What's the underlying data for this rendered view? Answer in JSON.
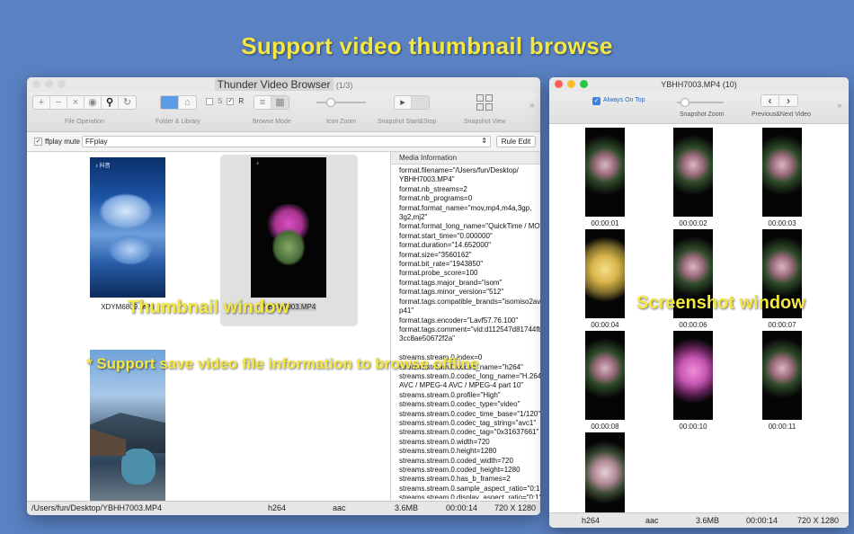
{
  "headline": "Support video thumbnail browse",
  "overlays": {
    "thumbnail_window": "Thumbnail window",
    "support_save": "* Support save video file information to browse offline",
    "screenshot_window": "Screenshot window"
  },
  "main_window": {
    "title": "Thunder Video Browser",
    "count": "(1/3)",
    "toolbar": {
      "file_operation": "File Operation",
      "folder_library": "Folder & Library",
      "s_label": "S",
      "r_label": "R",
      "browse_mode": "Browse Mode",
      "icon_zoom": "Icon Zoom",
      "snapshot_start_stop": "Snapshot  Start&Stop",
      "snapshot_view": "Snapshot View"
    },
    "subbar": {
      "ffplay_mute": "ffplay mute",
      "player_value": "FFplay",
      "rule_edit": "Rule Edit"
    },
    "thumbnails": [
      {
        "filename": "XDYM6809.MP4",
        "selected": false
      },
      {
        "filename": "YBHH7003.MP4",
        "selected": true
      },
      {
        "filename": "",
        "selected": false
      }
    ],
    "info_panel": {
      "header": "Media Information",
      "lines": [
        "format.filename=\"/Users/fun/Desktop/",
        "YBHH7003.MP4\"",
        "format.nb_streams=2",
        "format.nb_programs=0",
        "format.format_name=\"mov,mp4,m4a,3gp,",
        "3g2,mj2\"",
        "format.format_long_name=\"QuickTime / MOV\"",
        "format.start_time=\"0.000000\"",
        "format.duration=\"14.652000\"",
        "format.size=\"3560162\"",
        "format.bit_rate=\"1943850\"",
        "format.probe_score=100",
        "format.tags.major_brand=\"isom\"",
        "format.tags.minor_version=\"512\"",
        "format.tags.compatible_brands=\"isomiso2avc1m",
        "p41\"",
        "format.tags.encoder=\"Lavf57.76.100\"",
        "format.tags.comment=\"vid:d112547d81744fb286",
        "3cc8ae50672f2a\"",
        "",
        "streams.stream.0.index=0",
        "streams.stream.0.codec_name=\"h264\"",
        "streams.stream.0.codec_long_name=\"H.264 /",
        "AVC / MPEG-4 AVC / MPEG-4 part 10\"",
        "streams.stream.0.profile=\"High\"",
        "streams.stream.0.codec_type=\"video\"",
        "streams.stream.0.codec_time_base=\"1/120\"",
        "streams.stream.0.codec_tag_string=\"avc1\"",
        "streams.stream.0.codec_tag=\"0x31637661\"",
        "streams.stream.0.width=720",
        "streams.stream.0.height=1280",
        "streams.stream.0.coded_width=720",
        "streams.stream.0.coded_height=1280",
        "streams.stream.0.has_b_frames=2",
        "streams.stream.0.sample_aspect_ratio=\"0:1\"",
        "streams.stream.0.display_aspect_ratio=\"0:1\""
      ]
    },
    "status": {
      "path": "/Users/fun/Desktop/YBHH7003.MP4",
      "vcodec": "h264",
      "acodec": "aac",
      "size": "3.6MB",
      "duration": "00:00:14",
      "resolution": "720 X 1280"
    }
  },
  "snapshot_window": {
    "title": "YBHH7003.MP4",
    "count": "(10)",
    "always_on_top": "Always On Top",
    "always_on_top_checked": true,
    "snapshot_zoom": "Snapshot Zoom",
    "prev_next": "Previous&Next Video",
    "frames": [
      {
        "time": "00:00:01",
        "style": "cactus"
      },
      {
        "time": "00:00:02",
        "style": "cactus"
      },
      {
        "time": "00:00:03",
        "style": "cactus"
      },
      {
        "time": "00:00:04",
        "style": "yellow"
      },
      {
        "time": "00:00:06",
        "style": "cactus"
      },
      {
        "time": "00:00:07",
        "style": "cactus"
      },
      {
        "time": "00:00:08",
        "style": "cactus"
      },
      {
        "time": "00:00:10",
        "style": "pink"
      },
      {
        "time": "00:00:11",
        "style": "cactus"
      },
      {
        "time": "",
        "style": "white"
      }
    ],
    "status": {
      "vcodec": "h264",
      "acodec": "aac",
      "size": "3.6MB",
      "duration": "00:00:14",
      "resolution": "720 X 1280"
    }
  },
  "colors": {
    "desktop": "#5a82c3",
    "overlay_text": "#f5e742",
    "accent": "#3b82e0"
  },
  "icons": {
    "add": "+",
    "remove": "−",
    "close": "×",
    "eye": "◉",
    "search": "⚲",
    "refresh": "↻",
    "prev": "‹",
    "next": "›",
    "play": "▸",
    "overflow": "»"
  }
}
